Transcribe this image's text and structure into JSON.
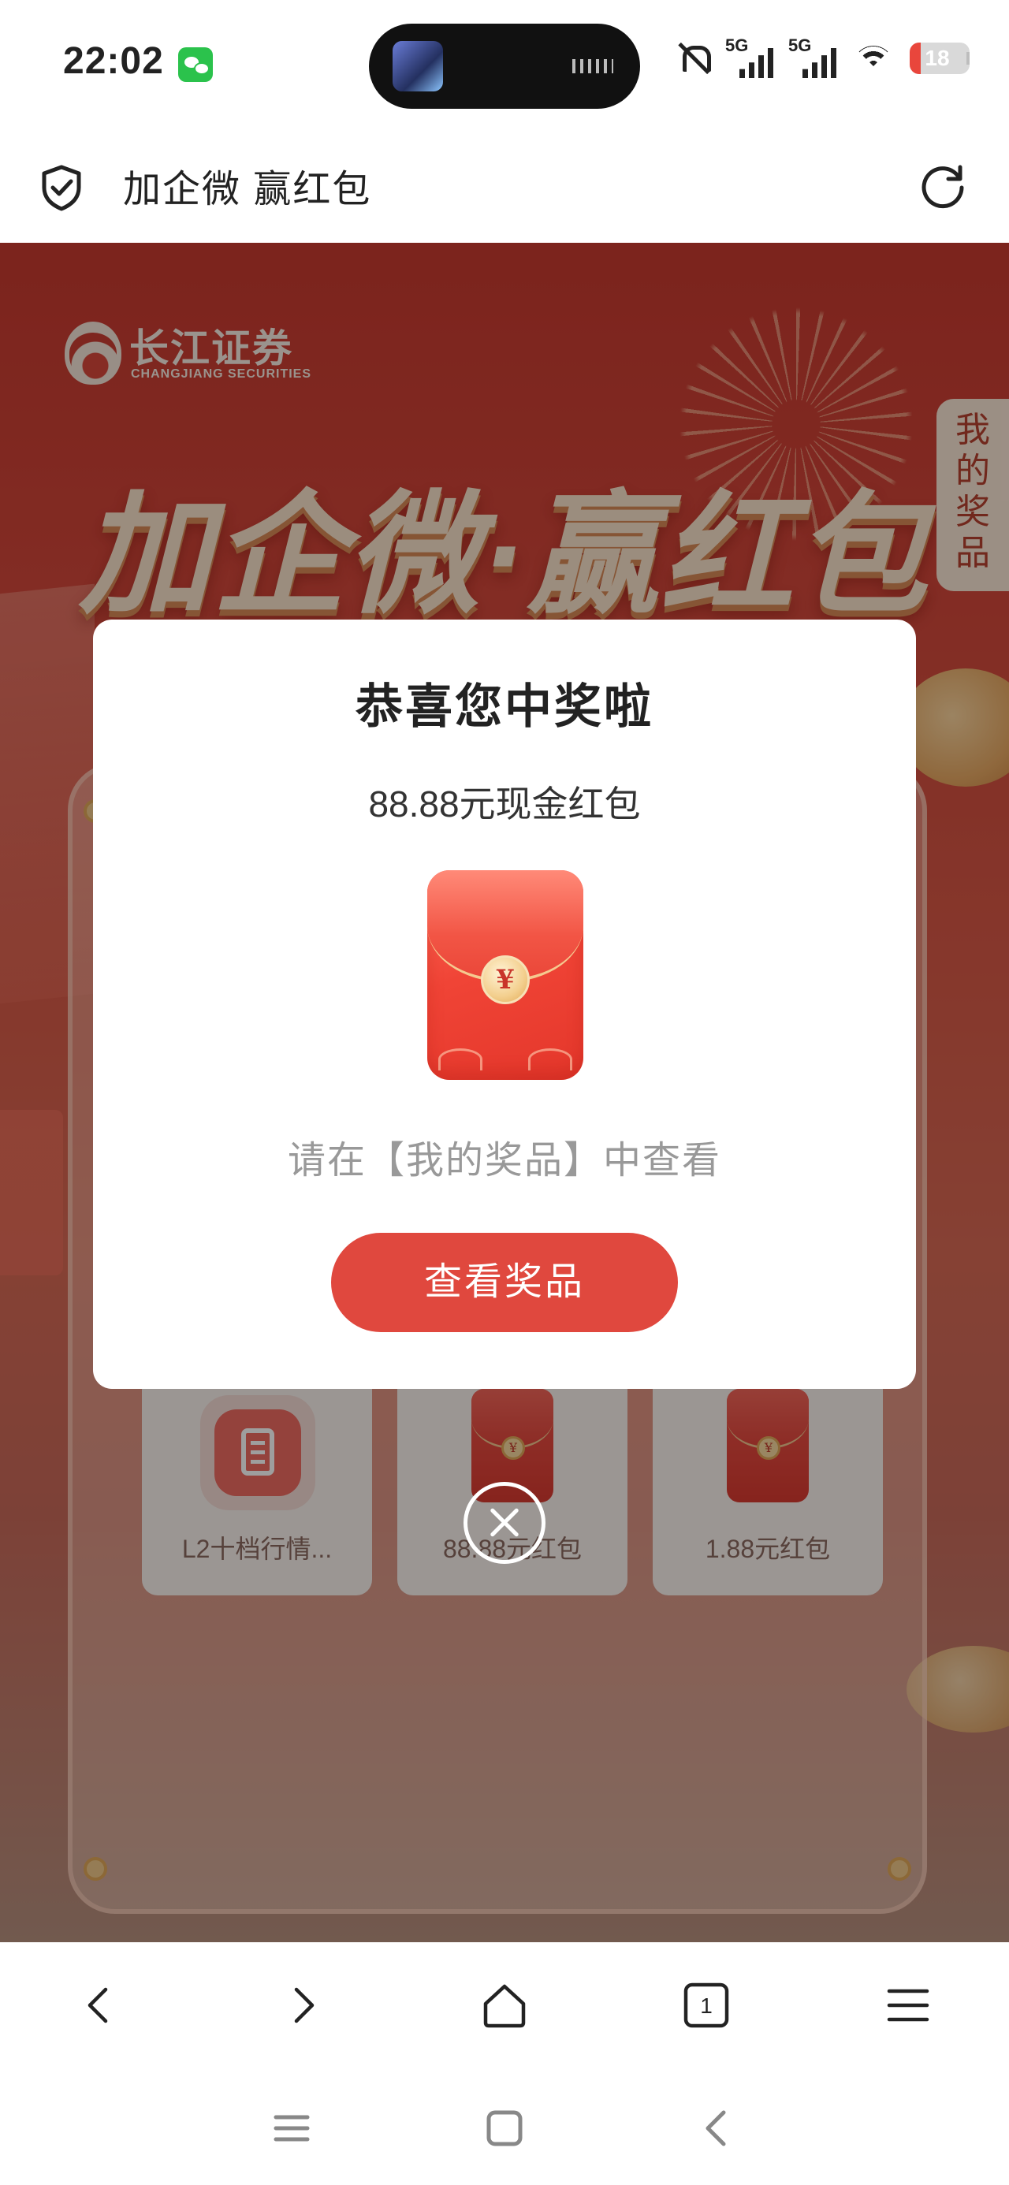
{
  "status_bar": {
    "time": "22:02",
    "network_1": "5G",
    "network_2": "5G",
    "battery": "18",
    "icons": [
      "wechat-icon",
      "bell-muted-icon",
      "signal-icon",
      "wifi-icon",
      "battery-icon"
    ]
  },
  "browser": {
    "page_title": "加企微 赢红包",
    "icons": [
      "shield-check-icon",
      "refresh-icon"
    ]
  },
  "page": {
    "brand_name": "长江证券",
    "brand_sub": "CHANGJIANG SECURITIES",
    "hero_title": "加企微·赢红包",
    "my_prizes_tab": "我的奖品",
    "prizes": [
      {
        "label": "L2十档行情...",
        "icon": "document-app-icon"
      },
      {
        "label": "88.88元红包",
        "icon": "red-envelope-icon"
      },
      {
        "label": "1.88元红包",
        "icon": "red-envelope-icon"
      }
    ]
  },
  "modal": {
    "title": "恭喜您中奖啦",
    "prize": "88.88元现金红包",
    "envelope_symbol": "¥",
    "hint": "请在【我的奖品】中查看",
    "button": "查看奖品",
    "close_icon": "close-circle-icon"
  },
  "toolbar": {
    "tab_count": "1",
    "icons": [
      "back-icon",
      "forward-icon",
      "home-icon",
      "tabs-icon",
      "menu-icon"
    ]
  },
  "system_nav": {
    "icons": [
      "recents-icon",
      "home-square-icon",
      "back-icon"
    ]
  },
  "colors": {
    "accent_red": "#e0483e",
    "page_red": "#c83a2f",
    "wechat_green": "#2bc24c"
  }
}
